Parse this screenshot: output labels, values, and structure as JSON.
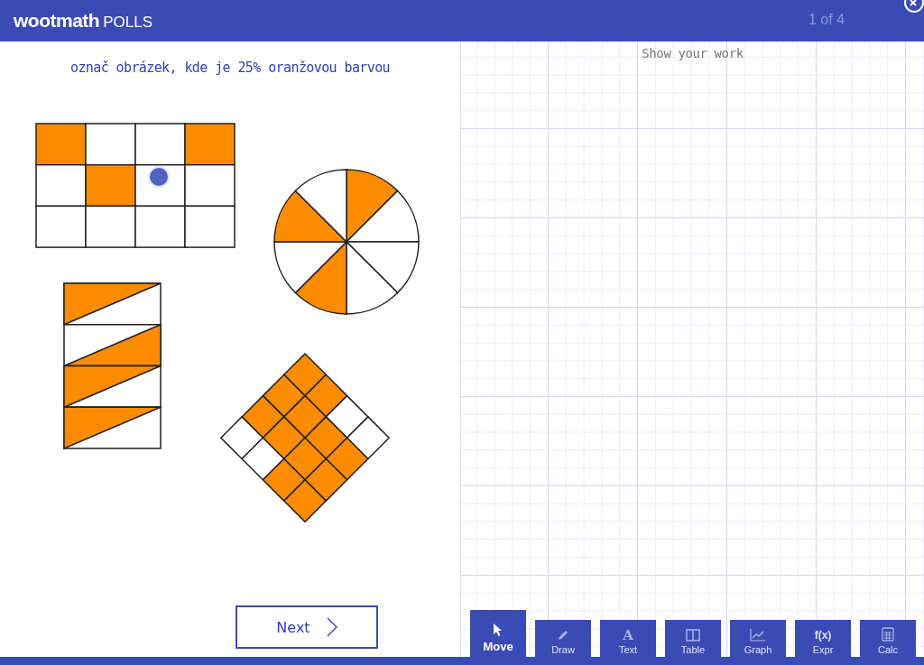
{
  "header": {
    "logo": "wootmath",
    "product": "POLLS",
    "progress": "1 of 4"
  },
  "question": "označ obrázek, kde je 25% oranžovou barvou",
  "figures": [
    {
      "kind": "grid",
      "selected": true
    },
    {
      "kind": "pie",
      "selected": false
    },
    {
      "kind": "zigzag",
      "selected": false
    },
    {
      "kind": "diamond",
      "selected": false
    }
  ],
  "next_button": "Next",
  "workspace": {
    "label": "Show your work"
  },
  "tools": [
    {
      "label": "Move",
      "kind": "cursor",
      "selected": true
    },
    {
      "label": "Draw",
      "kind": "pencil",
      "selected": false
    },
    {
      "label": "Text",
      "kind": "glyph",
      "glyph": "A",
      "selected": false
    },
    {
      "label": "Table",
      "kind": "table",
      "selected": false
    },
    {
      "label": "Graph",
      "kind": "graph",
      "selected": false
    },
    {
      "label": "Expr",
      "kind": "glyph",
      "glyph": "f(x)",
      "selected": false
    },
    {
      "label": "Calc",
      "kind": "calc",
      "selected": false
    }
  ]
}
